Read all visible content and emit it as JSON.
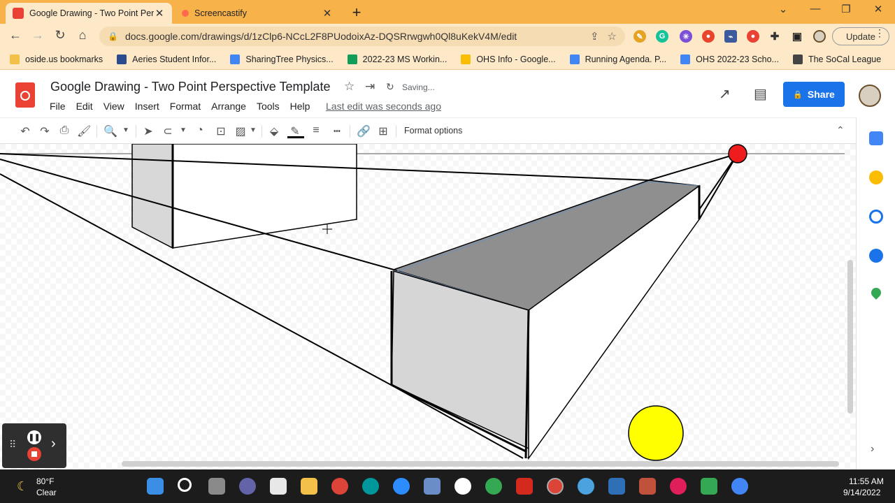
{
  "browser": {
    "tabs": [
      {
        "label": "Google Drawing - Two Point Pers",
        "active": true,
        "favicon": "google-drawings-icon"
      },
      {
        "label": "Screencastify",
        "active": false,
        "favicon": "screencastify-icon"
      }
    ],
    "url": "docs.google.com/drawings/d/1zClp6-NCcL2F8PUodoixAz-DQSRrwgwh0Ql8uKekV4M/edit",
    "update_label": "Update",
    "bookmarks": [
      {
        "label": "oside.us bookmarks",
        "icon": "folder-icon",
        "color": "#f3c04a"
      },
      {
        "label": "Aeries Student Infor...",
        "icon": "aeries-icon",
        "color": "#2a4b8d"
      },
      {
        "label": "SharingTree Physics...",
        "icon": "docs-icon",
        "color": "#4285f4"
      },
      {
        "label": "2022-23 MS Workin...",
        "icon": "sheets-icon",
        "color": "#0f9d58"
      },
      {
        "label": "OHS Info - Google...",
        "icon": "drive-icon",
        "color": "#fbbc04"
      },
      {
        "label": "Running Agenda. P...",
        "icon": "docs-icon",
        "color": "#4285f4"
      },
      {
        "label": "OHS 2022-23 Scho...",
        "icon": "docs-icon",
        "color": "#4285f4"
      },
      {
        "label": "The SoCal League",
        "icon": "cube-icon",
        "color": "#444444"
      }
    ]
  },
  "app": {
    "title": "Google Drawing - Two Point Perspective Template",
    "saving": "Saving...",
    "menus": [
      "File",
      "Edit",
      "View",
      "Insert",
      "Format",
      "Arrange",
      "Tools",
      "Help"
    ],
    "last_edit": "Last edit was seconds ago",
    "share_label": "Share",
    "format_options": "Format options"
  },
  "canvas": {
    "vanishing_point_color": "#ee1c1c",
    "sun_color": "#ffff00",
    "top_face_color": "#8f8f8f",
    "side_face_color": "#d6d6d6"
  },
  "taskbar": {
    "temperature": "80°F",
    "condition": "Clear",
    "time": "11:55 AM",
    "date": "9/14/2022"
  },
  "colors": {
    "tabstrip": "#f7b24a",
    "chrome_bar": "#fde9c7",
    "share_blue": "#1a73e8",
    "drawings_red": "#e94235"
  }
}
